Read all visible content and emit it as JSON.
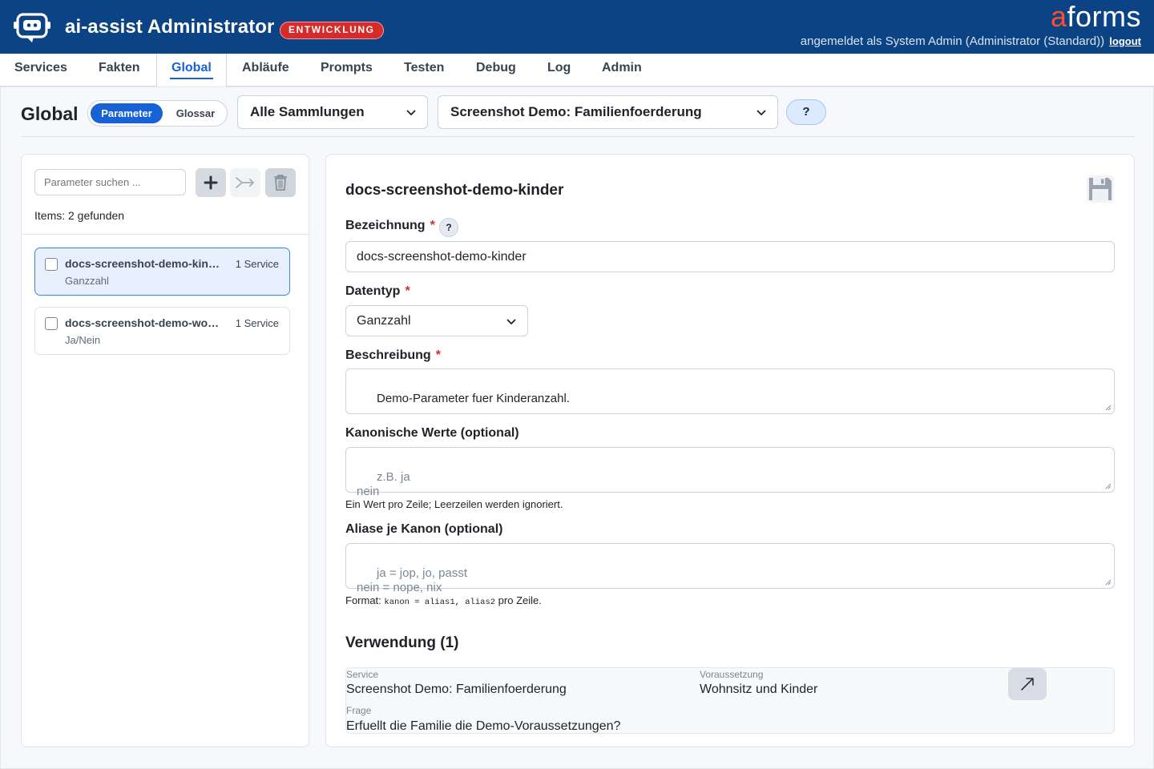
{
  "header": {
    "app_title": "ai-assist Administrator",
    "env_badge": "ENTWICKLUNG",
    "brand_a": "a",
    "brand_rest": "forms",
    "user_text": "angemeldet als System Admin (Administrator (Standard))",
    "logout_label": "logout",
    "colors": {
      "bar": "#0b4385",
      "badge": "#d72a2a",
      "brand_accent": "#ff4d2e"
    }
  },
  "nav": {
    "items": [
      {
        "label": "Services"
      },
      {
        "label": "Fakten"
      },
      {
        "label": "Global",
        "active": true
      },
      {
        "label": "Abläufe"
      },
      {
        "label": "Prompts"
      },
      {
        "label": "Testen"
      },
      {
        "label": "Debug"
      },
      {
        "label": "Log"
      },
      {
        "label": "Admin"
      }
    ]
  },
  "toolbar": {
    "page_title": "Global",
    "segment_on": "Parameter",
    "segment_off": "Glossar",
    "collection_select": "Alle Sammlungen",
    "service_select": "Screenshot Demo: Familienfoerderung",
    "help_label": "?"
  },
  "list": {
    "search_placeholder": "Parameter suchen ...",
    "count_text": "Items: 2 gefunden",
    "items": [
      {
        "name": "docs-screenshot-demo-kinder",
        "services": "1 Service",
        "type": "Ganzzahl",
        "selected": true
      },
      {
        "name": "docs-screenshot-demo-wohnsitz",
        "services": "1 Service",
        "type": "Ja/Nein",
        "selected": false
      }
    ]
  },
  "detail": {
    "title": "docs-screenshot-demo-kinder",
    "bezeichnung_label": "Bezeichnung",
    "required_mark": "*",
    "help_mark": "?",
    "bezeichnung_value": "docs-screenshot-demo-kinder",
    "datentyp_label": "Datentyp",
    "datentyp_value": "Ganzzahl",
    "beschreibung_label": "Beschreibung",
    "beschreibung_value": "Demo-Parameter fuer Kinderanzahl.",
    "kanon_label": "Kanonische Werte (optional)",
    "kanon_placeholder": "z.B. ja\nnein",
    "kanon_hint": "Ein Wert pro Zeile; Leerzeilen werden ignoriert.",
    "alias_label": "Aliase je Kanon (optional)",
    "alias_placeholder": "ja = jop, jo, passt\nnein = nope, nix",
    "alias_hint_prefix": "Format:",
    "alias_hint_code": "kanon = alias1, alias2",
    "alias_hint_suffix": "pro Zeile.",
    "usage_title": "Verwendung (1)",
    "usage": {
      "service_label": "Service",
      "service_value": "Screenshot Demo: Familienfoerderung",
      "voraussetzung_label": "Voraussetzung",
      "voraussetzung_value": "Wohnsitz und Kinder",
      "frage_label": "Frage",
      "frage_value": "Erfuellt die Familie die Demo-Voraussetzungen?"
    }
  }
}
